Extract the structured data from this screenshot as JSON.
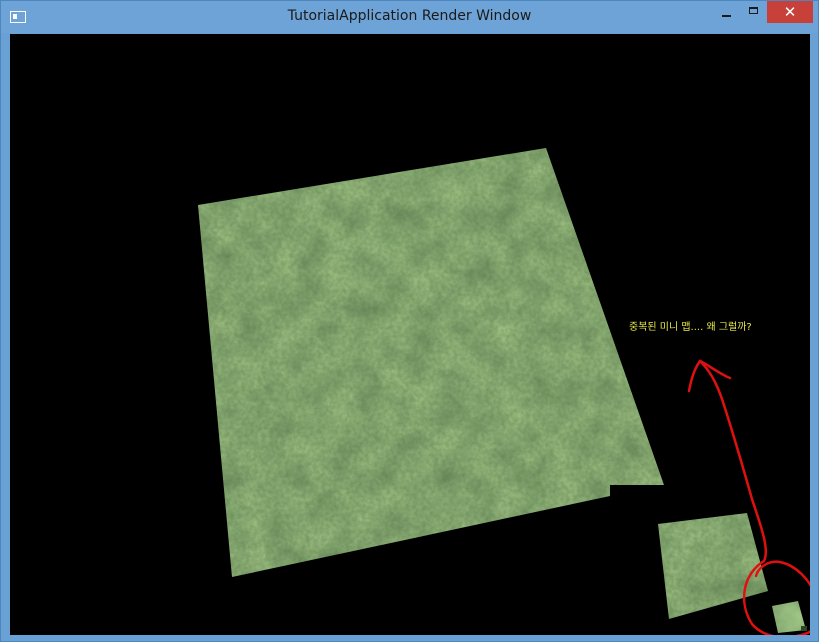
{
  "window": {
    "title": "TutorialApplication Render Window",
    "close_glyph": "✕",
    "icons": {
      "app": "app-window-icon",
      "minimize": "minimize-icon",
      "maximize": "maximize-icon",
      "close": "close-icon"
    }
  },
  "viewport": {
    "background": "#000000",
    "caption": "중복된 미니 맵.... 왜 그럴까?"
  },
  "colors": {
    "titlebar": "#6da3d6",
    "close_button": "#c7413a",
    "caption_text": "#e9e94a",
    "terrain": "#3b5a2c",
    "annotation_stroke": "#e01010"
  }
}
